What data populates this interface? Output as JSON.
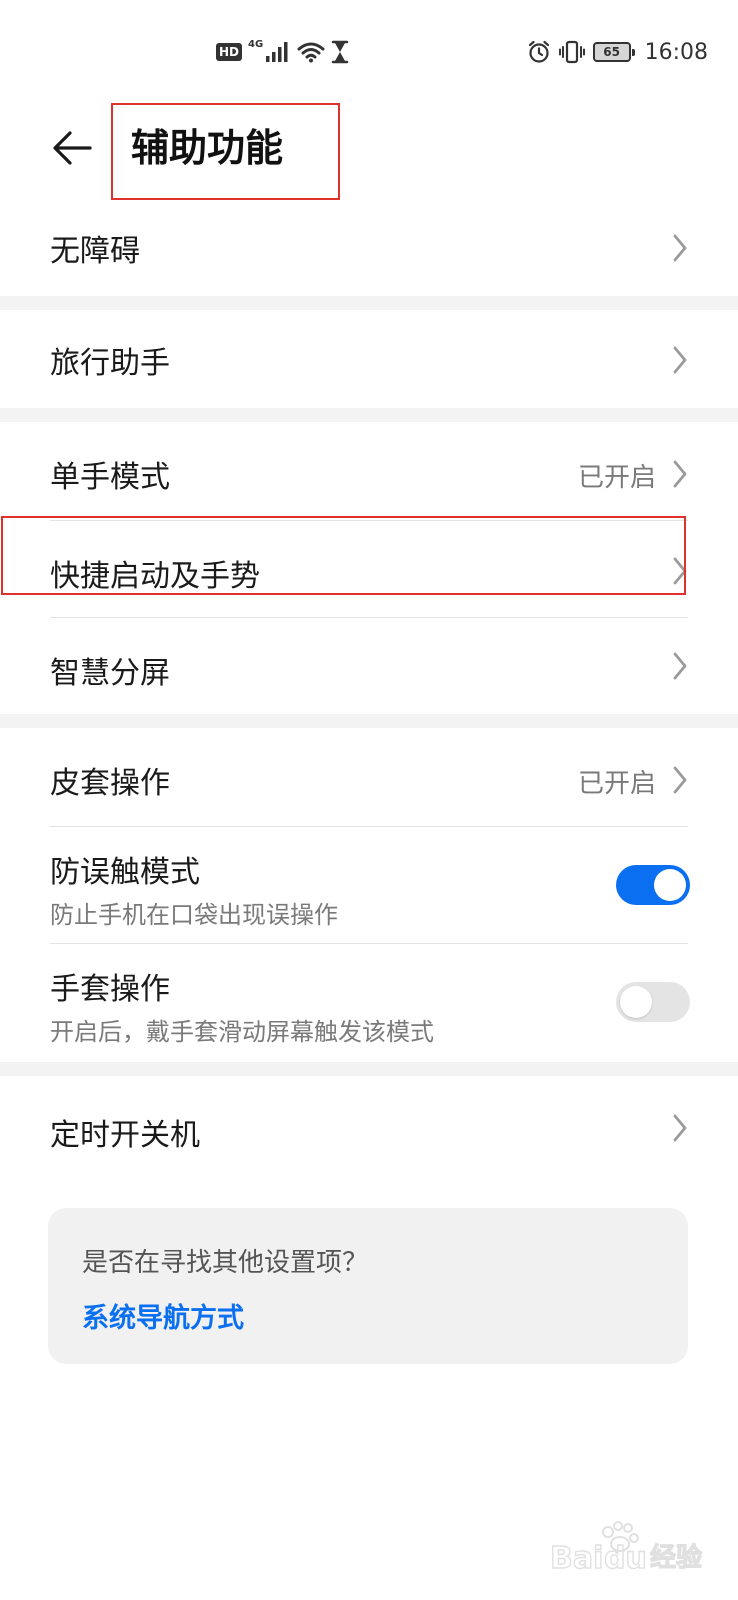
{
  "status_bar": {
    "hd_label": "HD",
    "network_type": "4G",
    "battery_level": "65",
    "time": "16:08"
  },
  "header": {
    "title": "辅助功能"
  },
  "groups": [
    {
      "rows": [
        {
          "title": "无障碍"
        }
      ]
    },
    {
      "rows": [
        {
          "title": "旅行助手"
        }
      ]
    },
    {
      "rows": [
        {
          "title": "单手模式",
          "value": "已开启"
        },
        {
          "title": "快捷启动及手势"
        },
        {
          "title": "智慧分屏"
        }
      ]
    },
    {
      "rows": [
        {
          "title": "皮套操作",
          "value": "已开启"
        },
        {
          "title": "防误触模式",
          "subtitle": "防止手机在口袋出现误操作",
          "toggle_on": true
        },
        {
          "title": "手套操作",
          "subtitle": "开启后，戴手套滑动屏幕触发该模式",
          "toggle_on": false
        }
      ]
    },
    {
      "rows": [
        {
          "title": "定时开关机"
        }
      ]
    }
  ],
  "suggestion_card": {
    "question": "是否在寻找其他设置项？",
    "link": "系统导航方式"
  },
  "colors": {
    "accent": "#0a6ff0",
    "highlight": "#e0312b",
    "group_gap": "#f3f3f3",
    "card_background": "#f1f1f1"
  },
  "icons": {
    "back": "arrow-left-icon",
    "chevron": "chevron-right-icon",
    "wifi": "wifi-icon",
    "signal": "signal-bars-icon",
    "hourglass": "hourglass-icon",
    "alarm": "alarm-clock-icon",
    "vibrate": "vibrate-icon",
    "battery": "battery-icon"
  }
}
